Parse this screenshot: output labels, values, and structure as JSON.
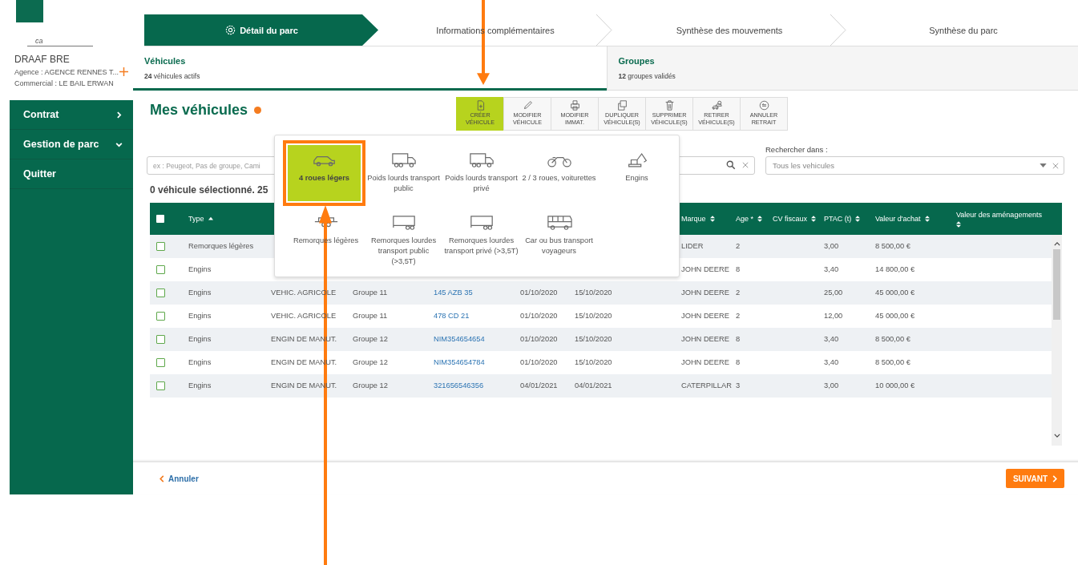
{
  "sidebar": {
    "logo_text": "ca",
    "client": "DRAAF BRE",
    "agence": "Agence : AGENCE RENNES T...",
    "commercial": "Commercial : LE BAIL ERWAN",
    "items": [
      {
        "label": "Contrat",
        "kind": "submenu",
        "expanded": false
      },
      {
        "label": "Gestion de parc",
        "kind": "submenu",
        "expanded": true
      },
      {
        "label": "Quitter",
        "kind": "link"
      }
    ]
  },
  "steps": [
    {
      "label": "Détail du parc",
      "selected": true
    },
    {
      "label": "Informations complémentaires",
      "selected": false
    },
    {
      "label": "Synthèse des mouvements",
      "selected": false
    },
    {
      "label": "Synthèse du parc",
      "selected": false
    }
  ],
  "tabs": [
    {
      "title": "Véhicules",
      "count": "24",
      "caption": "véhicules actifs",
      "selected": true
    },
    {
      "title": "Groupes",
      "count": "12",
      "caption": "groupes validés",
      "selected": false
    }
  ],
  "page_title": "Mes véhicules",
  "toolbar": [
    {
      "label": "CRÉER VÉHICULE",
      "selected": true
    },
    {
      "label": "MODIFIER VÉHICULE",
      "selected": false
    },
    {
      "label": "MODIFIER IMMAT.",
      "selected": false
    },
    {
      "label": "DUPLIQUER VÉHICULE(S)",
      "selected": false
    },
    {
      "label": "SUPPRIMER VÉHICULE(S)",
      "selected": false
    },
    {
      "label": "RETIRER VÉHICULE(S)",
      "selected": false
    },
    {
      "label": "ANNULER RETRAIT",
      "selected": false
    }
  ],
  "vehicle_menu": [
    {
      "label": "4 roues légers",
      "selected": true,
      "highlighted": true
    },
    {
      "label": "Poids lourds transport public",
      "selected": false,
      "highlighted": false
    },
    {
      "label": "Poids lourds transport privé",
      "selected": false,
      "highlighted": false
    },
    {
      "label": "2 / 3 roues, voiturettes",
      "selected": false,
      "highlighted": false
    },
    {
      "label": "Engins",
      "selected": false,
      "highlighted": false
    },
    {
      "label": "Remorques légères",
      "selected": false,
      "highlighted": false
    },
    {
      "label": "Remorques lourdes transport public (>3,5T)",
      "selected": false,
      "highlighted": false
    },
    {
      "label": "Remorques lourdes transport privé (>3,5T)",
      "selected": false,
      "highlighted": false
    },
    {
      "label": "Car ou bus transport voyageurs",
      "selected": false,
      "highlighted": false
    }
  ],
  "search": {
    "placeholder": "ex : Peugeot, Pas de groupe, Cami"
  },
  "scope": {
    "label": "Rechercher dans :",
    "value": "Tous les vehicules"
  },
  "selection_summary": "0 véhicule sélectionné. 25",
  "table": {
    "select_all_checked": false,
    "columns": [
      {
        "label": "Type"
      },
      {
        "label": "Marque"
      },
      {
        "label": "Age *"
      },
      {
        "label": "CV fiscaux"
      },
      {
        "label": "PTAC (t)"
      },
      {
        "label": "Valeur d'achat"
      },
      {
        "label": "Valeur des aménagements"
      }
    ],
    "rows": [
      {
        "checked": false,
        "type": "Remorques légères",
        "marque": "LIDER",
        "age": "2",
        "ptac": "3,00",
        "valeur": "8 500,00 €"
      },
      {
        "checked": false,
        "type": "Engins",
        "marque": "JOHN DEERE",
        "age": "8",
        "ptac": "3,40",
        "valeur": "14 800,00 €"
      },
      {
        "checked": false,
        "type": "Engins",
        "column_3": "VEHIC. AGRICOLE",
        "column_4": "Groupe 11",
        "column_5": "145 AZB 35",
        "column_6": "01/10/2020",
        "column_7": "15/10/2020",
        "marque": "JOHN DEERE",
        "age": "2",
        "ptac": "25,00",
        "valeur": "45 000,00 €"
      },
      {
        "checked": false,
        "type": "Engins",
        "column_3": "VEHIC. AGRICOLE",
        "column_4": "Groupe 11",
        "column_5": "478 CD 21",
        "column_6": "01/10/2020",
        "column_7": "15/10/2020",
        "marque": "JOHN DEERE",
        "age": "2",
        "ptac": "12,00",
        "valeur": "45 000,00 €"
      },
      {
        "checked": false,
        "type": "Engins",
        "column_3": "ENGIN DE MANUT.",
        "column_4": "Groupe 12",
        "column_5": "NIM354654654",
        "column_6": "01/10/2020",
        "column_7": "15/10/2020",
        "marque": "JOHN DEERE",
        "age": "8",
        "ptac": "3,40",
        "valeur": "8 500,00 €"
      },
      {
        "checked": false,
        "type": "Engins",
        "column_3": "ENGIN DE MANUT.",
        "column_4": "Groupe 12",
        "column_5": "NIM354654784",
        "column_6": "01/10/2020",
        "column_7": "15/10/2020",
        "marque": "JOHN DEERE",
        "age": "8",
        "ptac": "3,40",
        "valeur": "8 500,00 €"
      },
      {
        "checked": false,
        "type": "Engins",
        "column_3": "ENGIN DE MANUT.",
        "column_4": "Groupe 12",
        "column_5": "321656546356",
        "column_6": "04/01/2021",
        "column_7": "04/01/2021",
        "marque": "CATERPILLAR",
        "age": "3",
        "ptac": "3,00",
        "valeur": "10 000,00 €"
      }
    ]
  },
  "footer": {
    "cancel": "Annuler",
    "next": "SUIVANT"
  }
}
